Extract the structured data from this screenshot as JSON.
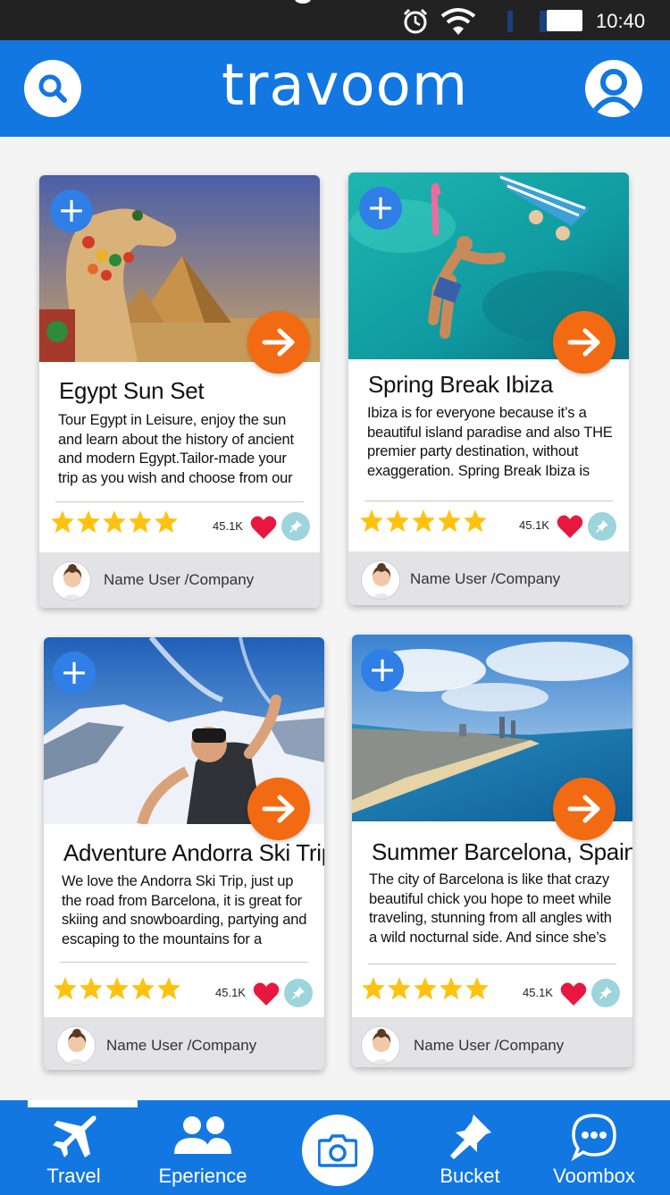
{
  "status_bar": {
    "time": "10:40",
    "icons": [
      "alarm-icon",
      "wifi-icon",
      "signal-icon",
      "battery-icon"
    ]
  },
  "header": {
    "logo_text": "travoom",
    "left_icon": "search-icon",
    "right_icon": "profile-icon",
    "background": "#1377e2"
  },
  "cards": [
    {
      "title": "Egypt Sun Set",
      "description": "Tour Egypt in Leisure, enjoy the sun and learn about the history of ancient and modern Egypt.Tailor-made your trip as you wish and choose from our",
      "rating": 5,
      "likes": "45.1K",
      "user": "Name User /Company",
      "image": "camel-pyramids-photo"
    },
    {
      "title": "Spring Break Ibiza",
      "description": "Ibiza is for everyone because it’s a beautiful island paradise and also THE premier party destination, without exaggeration. Spring Break Ibiza is",
      "rating": 5,
      "likes": "45.1K",
      "user": "Name User /Company",
      "image": "cliff-jump-sea-photo"
    },
    {
      "title": "Adventure Andorra Ski Trip",
      "description": "We love the Andorra Ski Trip, just up the road from Barcelona, it is great for skiing and snowboarding, partying and escaping to the mountains for a weekend break.",
      "rating": 5,
      "likes": "45.1K",
      "user": "Name User /Company",
      "image": "ski-selfie-photo"
    },
    {
      "title": "Summer Barcelona, Spain",
      "description": "The city of Barcelona is like that crazy beautiful chick you hope to meet while traveling, stunning from all angles with a wild nocturnal side. And since she’s our",
      "rating": 5,
      "likes": "45.1K",
      "user": "Name User /Company",
      "image": "barcelona-coast-photo"
    }
  ],
  "bottom_nav": {
    "items": [
      {
        "label": "Travel",
        "icon": "airplane-icon",
        "active": true
      },
      {
        "label": "Eperience",
        "icon": "people-icon",
        "active": false
      },
      {
        "label": "",
        "icon": "camera-icon",
        "active": false
      },
      {
        "label": "Bucket",
        "icon": "pushpin-icon",
        "active": false
      },
      {
        "label": "Voombox",
        "icon": "chat-bubble-icon",
        "active": false
      }
    ]
  },
  "colors": {
    "primary_blue": "#1377e2",
    "accent_orange": "#f26b12",
    "star_yellow": "#ffc20e",
    "heart_red": "#e8173f",
    "pin_teal": "#9ed4dc",
    "plus_blue": "#2f7fe6"
  }
}
